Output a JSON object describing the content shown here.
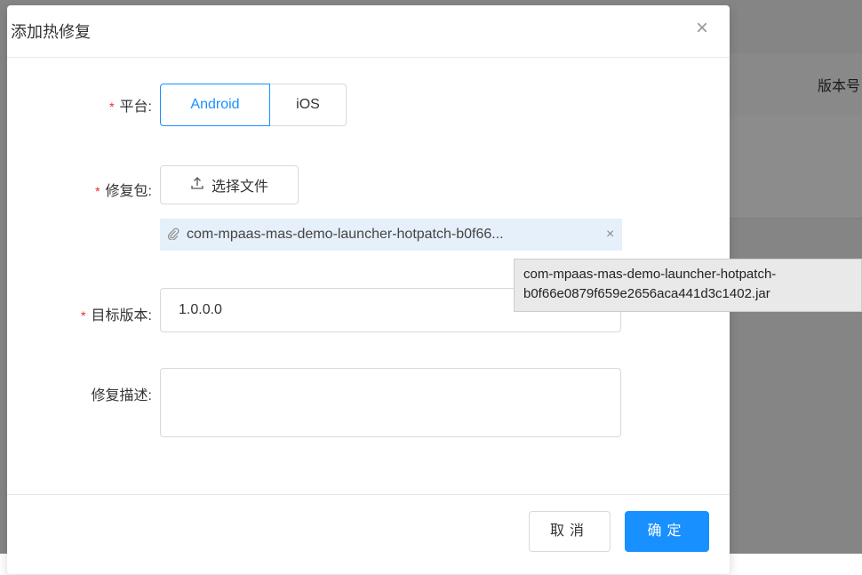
{
  "background": {
    "column_header": "版本号"
  },
  "modal": {
    "title": "添加热修复",
    "close_symbol": "×"
  },
  "form": {
    "required_mark": "*",
    "platform": {
      "label": "平台:",
      "options": [
        "Android",
        "iOS"
      ],
      "selected": "Android"
    },
    "package": {
      "label": "修复包:",
      "upload_button": "选择文件",
      "file_display": "com-mpaas-mas-demo-launcher-hotpatch-b0f66...",
      "remove_symbol": "×"
    },
    "target_version": {
      "label": "目标版本:",
      "value": "1.0.0.0"
    },
    "description": {
      "label": "修复描述:",
      "value": ""
    }
  },
  "tooltip": {
    "line1": "com-mpaas-mas-demo-launcher-hotpatch-",
    "line2": "b0f66e0879f659e2656aca441d3c1402.jar"
  },
  "footer": {
    "cancel_label": "取消",
    "ok_label": "确定"
  },
  "colors": {
    "primary": "#1890ff",
    "required": "#f5222d",
    "file_bg": "#e6f0fa"
  },
  "icons": {
    "upload": "upload-icon",
    "attachment": "paperclip-icon",
    "close": "close-icon"
  }
}
